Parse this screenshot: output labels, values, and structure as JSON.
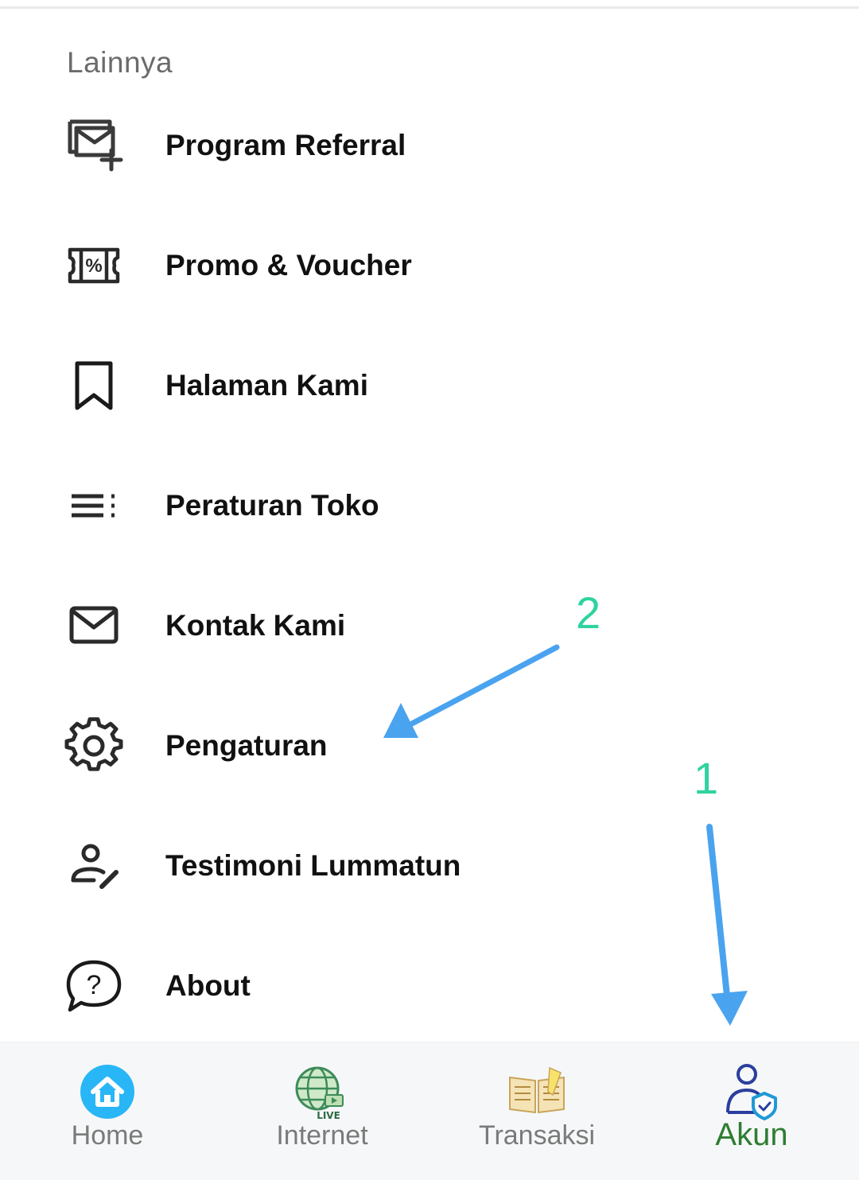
{
  "section": {
    "title": "Lainnya"
  },
  "menu": [
    {
      "label": "Program Referral",
      "icon": "referral-mail-plus-icon"
    },
    {
      "label": "Promo & Voucher",
      "icon": "voucher-percent-icon"
    },
    {
      "label": "Halaman Kami",
      "icon": "bookmark-icon"
    },
    {
      "label": "Peraturan Toko",
      "icon": "list-rules-icon"
    },
    {
      "label": "Kontak Kami",
      "icon": "mail-icon"
    },
    {
      "label": "Pengaturan",
      "icon": "gear-icon"
    },
    {
      "label": "Testimoni Lummatun",
      "icon": "user-edit-icon"
    },
    {
      "label": "About",
      "icon": "help-bubble-icon"
    }
  ],
  "annotations": {
    "step1": "1",
    "step2": "2",
    "color": "#2ed3a0",
    "arrow_color": "#4aa3ef"
  },
  "bottom_nav": {
    "items": [
      {
        "label": "Home",
        "icon": "home-icon"
      },
      {
        "label": "Internet",
        "icon": "globe-live-icon",
        "badge": "LIVE"
      },
      {
        "label": "Transaksi",
        "icon": "book-note-icon"
      },
      {
        "label": "Akun",
        "icon": "user-shield-icon",
        "active": true
      }
    ],
    "active_color": "#2e7d32",
    "home_color": "#29b6f6"
  }
}
